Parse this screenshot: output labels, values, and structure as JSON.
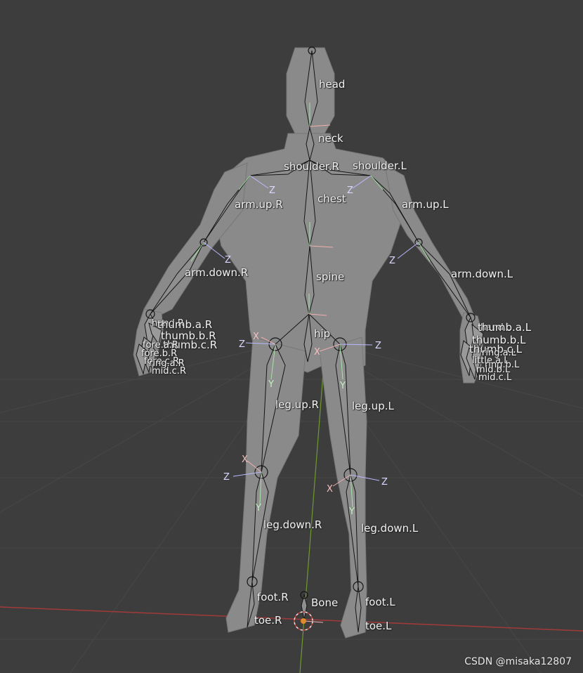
{
  "viewport": {
    "background": "#3d3d3d",
    "grid_color": "#474747",
    "x_axis_color": "#a33a3a",
    "y_axis_color": "#6f9a2e",
    "mesh_color": "#8a8a8a",
    "bone_color": "#151515"
  },
  "bones": {
    "head": "head",
    "neck": "neck",
    "shoulder_r": "shoulder.R",
    "shoulder_l": "shoulder.L",
    "chest": "chest",
    "arm_up_r": "arm.up.R",
    "arm_up_l": "arm.up.L",
    "arm_down_r": "arm.down.R",
    "arm_down_l": "arm.down.L",
    "spine": "spine",
    "hip": "hip",
    "hand_r": "hand.R",
    "thumb_a_r": "thumb.a.R",
    "thumb_b_r": "thumb.b.R",
    "thumb_c_r": "thumb.c.R",
    "finger_r_1": "fore.a.R",
    "finger_r_2": "fore.b.R",
    "finger_r_3": "fore.c.R",
    "finger_r_4": "ring.a.R",
    "finger_r_5": "mid.c.R",
    "hand_l": "hand.L",
    "thumb_a_l": "thumb.a.L",
    "thumb_b_l": "thumb.b.L",
    "thumb_c_l": "thumb.c.L",
    "finger_l_1": "ring.a.L",
    "finger_l_2": "little.a.L",
    "finger_l_3": "ring.b.L",
    "finger_l_4": "mid.b.L",
    "finger_l_5": "mid.c.L",
    "leg_up_r": "leg.up.R",
    "leg_up_l": "leg.up.L",
    "leg_down_r": "leg.down.R",
    "leg_down_l": "leg.down.L",
    "foot_r": "foot.R",
    "foot_l": "foot.L",
    "toe_r": "toe.R",
    "toe_l": "toe.L",
    "root": "Bone"
  },
  "axis_letters": {
    "x": "X",
    "y": "Y",
    "z": "Z"
  },
  "watermark": "CSDN @misaka12807"
}
